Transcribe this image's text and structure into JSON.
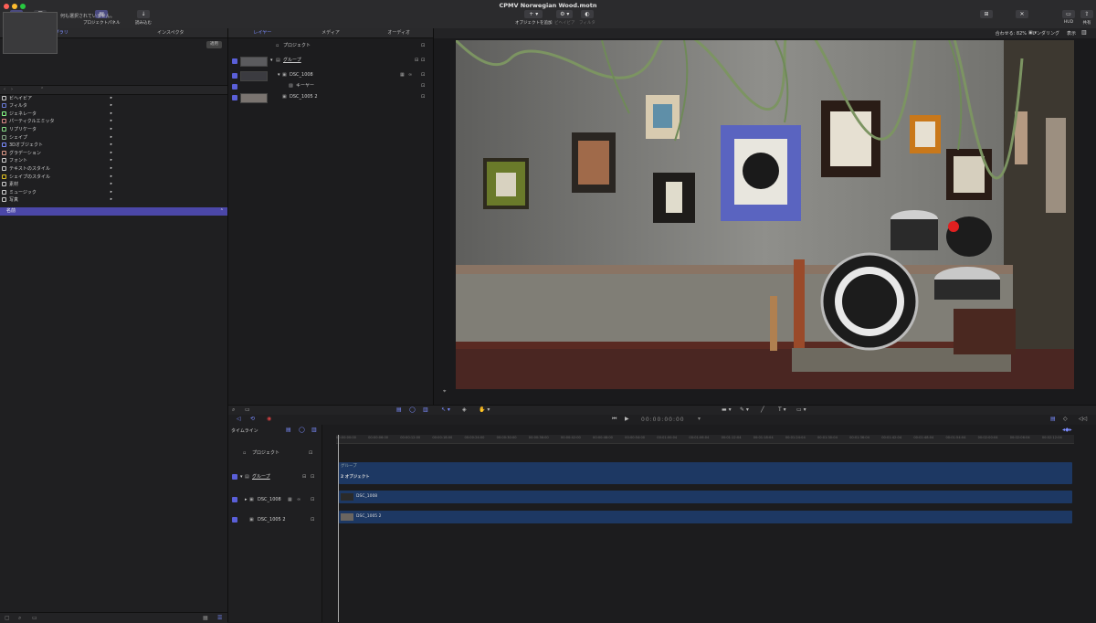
{
  "window": {
    "title": "CPMV Norwegian Wood.motn"
  },
  "toolbar": {
    "library": "ライブラリ",
    "inspector": "インスペクタ",
    "project_panel": "プロジェクトパネル",
    "import": "読み込む",
    "add_object": "オブジェクトを追加",
    "behaviors": "ビヘイビア",
    "filters": "フィルタ",
    "hud": "HUD",
    "share": "共有"
  },
  "left_panel": {
    "tabs": [
      "ライブラリ",
      "インスペクタ"
    ],
    "no_selection": "何も選択されていません。",
    "apply": "適用",
    "theme": "テーマ: すべて",
    "categories": [
      "ビヘイビア",
      "フィルタ",
      "ジェネレータ",
      "パーティクルエミッタ",
      "リプリケータ",
      "シェイプ",
      "3Dオブジェクト",
      "グラデーション",
      "フォント",
      "テキストのスタイル",
      "シェイプのスタイル",
      "素材",
      "ミュージック",
      "写真"
    ],
    "name_header": "名前"
  },
  "layers_panel": {
    "tabs": [
      "レイヤー",
      "メディア",
      "オーディオ"
    ],
    "rows": [
      {
        "label": "プロジェクト"
      },
      {
        "label": "グループ"
      },
      {
        "label": "DSC_1008"
      },
      {
        "label": "キーヤー"
      },
      {
        "label": "DSC_1005 2"
      }
    ]
  },
  "viewer": {
    "zoom": "合わせる: 82%",
    "render": "レンダリング",
    "view": "表示"
  },
  "transport": {
    "timecode": "00:00:00:00"
  },
  "timeline": {
    "label": "タイムライン",
    "rows": [
      {
        "label": "プロジェクト"
      },
      {
        "label": "グループ"
      },
      {
        "label": "DSC_1008"
      },
      {
        "label": "DSC_1005 2"
      }
    ],
    "ruler_ticks": [
      "00:00:00:00",
      "00:00:06:00",
      "00:00:12:00",
      "00:00:18:00",
      "00:00:24:00",
      "00:00:30:00",
      "00:00:36:00",
      "00:00:42:00",
      "00:00:48:00",
      "00:00:54:00",
      "00:01:00:04",
      "00:01:06:04",
      "00:01:12:04",
      "00:01:18:04",
      "00:01:24:04",
      "00:01:30:04",
      "00:01:36:04",
      "00:01:42:04",
      "00:01:48:04",
      "00:01:54:04",
      "00:02:00:04",
      "00:02:06:04",
      "00:02:12:04"
    ],
    "bars": {
      "group_title": "グループ",
      "group_sub": "2 オブジェクト",
      "clip1": "DSC_1008",
      "clip2": "DSC_1005 2"
    }
  },
  "colors": {
    "accent": "#5a5fd8",
    "clip": "#1d3863",
    "name_bar": "#4b47a8"
  }
}
